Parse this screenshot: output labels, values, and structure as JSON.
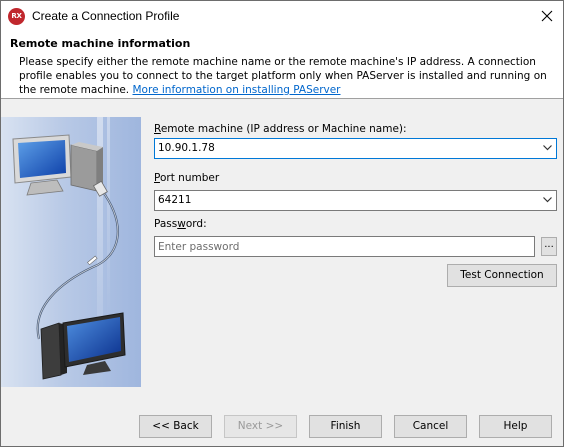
{
  "window": {
    "title": "Create a Connection Profile",
    "app_icon_text": "RX"
  },
  "header": {
    "title": "Remote machine information",
    "description": "Please specify either the remote machine name or the remote machine's IP address. A connection profile enables you to connect to the target platform only when PAServer is installed and running on the remote machine.",
    "link_text": "More information on installing PAServer"
  },
  "form": {
    "remote_machine": {
      "label_key": "R",
      "label_rest": "emote machine (IP address or Machine name):",
      "value": "10.90.1.78"
    },
    "port": {
      "label_key": "P",
      "label_rest": "ort number",
      "value": "64211"
    },
    "password": {
      "label_pre": "Pass",
      "label_key": "w",
      "label_rest": "ord:",
      "placeholder": "Enter password",
      "ellipsis": "..."
    },
    "test_connection": "Test Connection"
  },
  "buttons": {
    "back": "<< Back",
    "next": "Next >>",
    "finish": "Finish",
    "cancel": "Cancel",
    "help": "Help"
  },
  "icons": {
    "close": "close-icon",
    "dropdown": "chevron-down-icon"
  },
  "colors": {
    "app_icon": "#c0272d",
    "link": "#0066cc",
    "focus_border": "#0078d7"
  }
}
